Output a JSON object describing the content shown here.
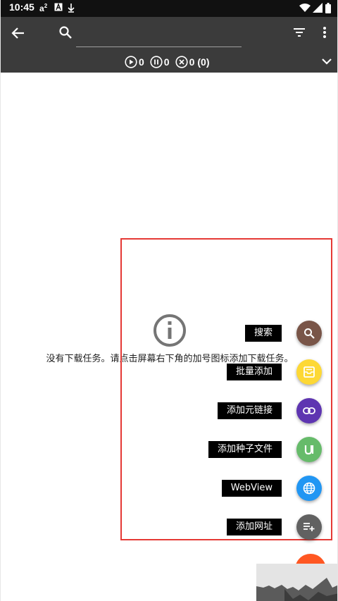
{
  "status_bar": {
    "time": "10:45",
    "indicators": [
      "a-superscript-2-icon",
      "a-box-icon",
      "download-arrow-icon"
    ],
    "right_icons": [
      "wifi-icon",
      "signal-icon",
      "battery-icon"
    ]
  },
  "toolbar": {
    "back_icon": "arrow-back-icon",
    "search_icon": "search-icon",
    "search_value": "",
    "filter_icon": "filter-icon",
    "more_icon": "more-vert-icon",
    "expand_icon": "chevron-down-icon",
    "counts": {
      "active": "0",
      "paused": "0",
      "failed": "0",
      "failed_extra": "(0)"
    }
  },
  "empty_state": {
    "icon": "info-icon",
    "message": "没有下载任务。请点击屏幕右下角的加号图标添加下载任务。"
  },
  "fab_menu": [
    {
      "label": "搜索",
      "icon": "search-icon",
      "color": "#795548"
    },
    {
      "label": "批量添加",
      "icon": "batch-inbox-icon",
      "color": "#fdd835"
    },
    {
      "label": "添加元链接",
      "icon": "link-icon",
      "color": "#5e35b1"
    },
    {
      "label": "添加种子文件",
      "icon": "torrent-icon",
      "color": "#66bb6a"
    },
    {
      "label": "WebView",
      "icon": "globe-icon",
      "color": "#2196f3"
    },
    {
      "label": "添加网址",
      "icon": "playlist-add-icon",
      "color": "#616161"
    }
  ],
  "main_fab": {
    "icon": "add-icon",
    "color": "#ff5722"
  }
}
